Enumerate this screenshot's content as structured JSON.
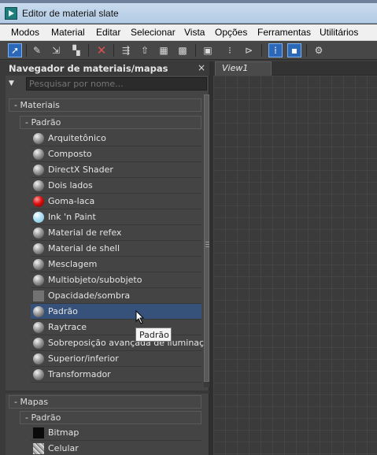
{
  "window": {
    "title": "Editor de material slate"
  },
  "menu": [
    "Modos",
    "Material",
    "Editar",
    "Selecionar",
    "Vista",
    "Opções",
    "Ferramentas",
    "Utilitários"
  ],
  "toolbar": {
    "icons": [
      "select-arrow-icon",
      "eyedropper-icon",
      "put-to-scene-icon",
      "assign-to-selection-icon",
      "delete-icon",
      "move-children-icon",
      "select-material-icon",
      "show-map-icon",
      "background-icon",
      "layout-all-icon",
      "layout-children-icon",
      "hide-unused-icon",
      "nav-grid-icon",
      "params-icon",
      "material-map-navigator-icon"
    ]
  },
  "browser": {
    "title": "Navegador de materiais/mapas",
    "close": "×",
    "search_placeholder": "Pesquisar por nome...",
    "materials_group": "- Materiais",
    "materials_subgroup": "- Padrão",
    "materials": [
      {
        "label": "Arquitetônico",
        "swatch": "sphere"
      },
      {
        "label": "Composto",
        "swatch": "sphere"
      },
      {
        "label": "DirectX Shader",
        "swatch": "sphere"
      },
      {
        "label": "Dois lados",
        "swatch": "sphere"
      },
      {
        "label": "Goma-laca",
        "swatch": "red-sphere"
      },
      {
        "label": "Ink 'n Paint",
        "swatch": "cyan-sphere"
      },
      {
        "label": "Material de refex",
        "swatch": "sphere"
      },
      {
        "label": "Material de shell",
        "swatch": "sphere"
      },
      {
        "label": "Mesclagem",
        "swatch": "sphere"
      },
      {
        "label": "Multiobjeto/subobjeto",
        "swatch": "sphere"
      },
      {
        "label": "Opacidade/sombra",
        "swatch": "gray-square"
      },
      {
        "label": "Padrão",
        "swatch": "sphere",
        "selected": true
      },
      {
        "label": "Raytrace",
        "swatch": "sphere"
      },
      {
        "label": "Sobreposição avançada de iluminação",
        "swatch": "sphere"
      },
      {
        "label": "Superior/inferior",
        "swatch": "sphere"
      },
      {
        "label": "Transformador",
        "swatch": "sphere"
      }
    ],
    "maps_group": "- Mapas",
    "maps_subgroup": "- Padrão",
    "maps": [
      {
        "label": "Bitmap",
        "swatch": "black-square"
      },
      {
        "label": "Celular",
        "swatch": "noise-square"
      }
    ]
  },
  "tooltip": {
    "text": "Padrão"
  },
  "view": {
    "tab": "View1"
  },
  "colors": {
    "selection": "#36527a",
    "accent": "#2c68b8",
    "panel": "#444444"
  }
}
